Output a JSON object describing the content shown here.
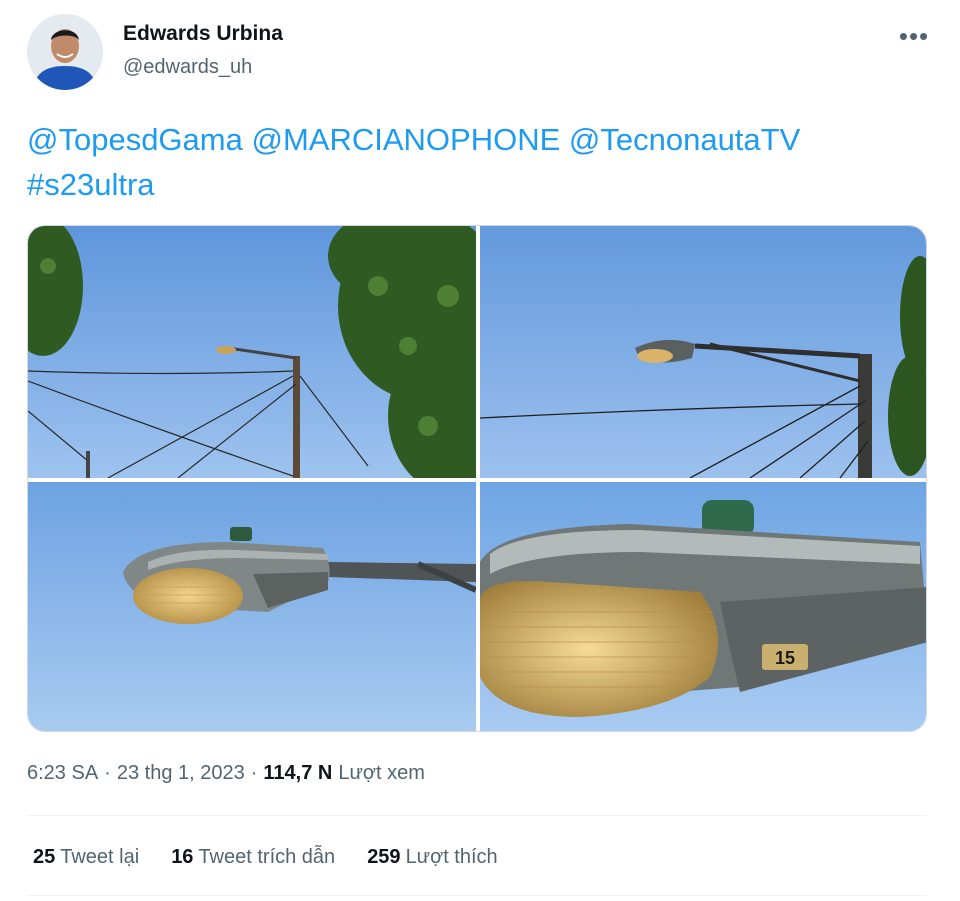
{
  "author": {
    "name": "Edwards Urbina",
    "handle": "@edwards_uh"
  },
  "more_menu_label": "•••",
  "tweet": {
    "mentions": [
      "@TopesdGama",
      "@MARCIANOPHONE",
      "@TecnonautaTV"
    ],
    "hashtag": "#s23ultra"
  },
  "media": {
    "photos": [
      {
        "label": "street-light-wide"
      },
      {
        "label": "street-light-zoom-2"
      },
      {
        "label": "street-light-zoom-3"
      },
      {
        "label": "street-light-zoom-4"
      }
    ],
    "plate_number": "15"
  },
  "meta": {
    "time": "6:23 SA",
    "separator": "·",
    "date": "23 thg 1, 2023",
    "views_count": "114,7 N",
    "views_label": "Lượt xem"
  },
  "stats": {
    "retweets_count": "25",
    "retweets_label": "Tweet lại",
    "quotes_count": "16",
    "quotes_label": "Tweet trích dẫn",
    "likes_count": "259",
    "likes_label": "Lượt thích"
  },
  "colors": {
    "link": "#1d9bf0",
    "sky": "#7fb0e6",
    "secondary_text": "#536471"
  }
}
